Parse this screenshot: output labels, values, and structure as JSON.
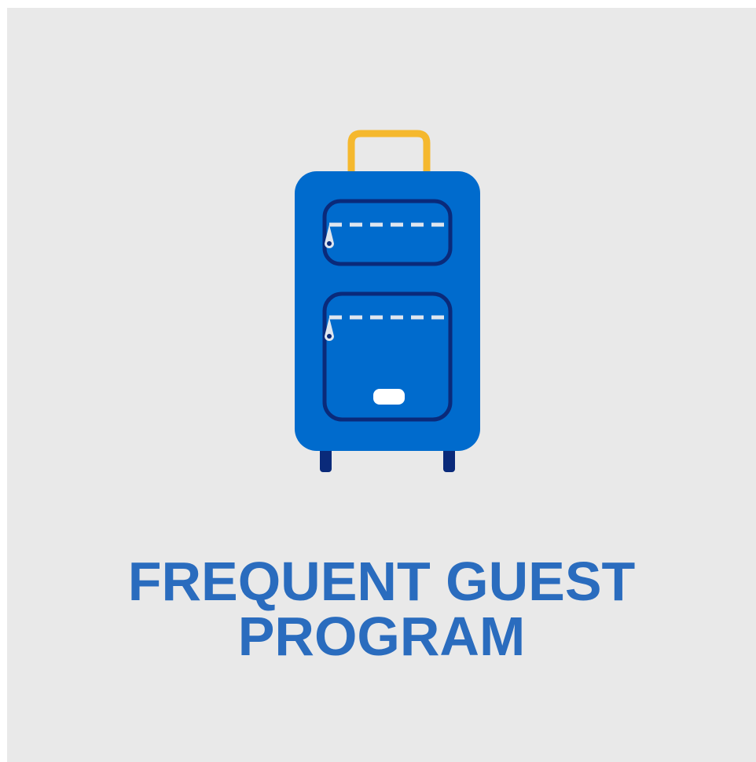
{
  "tile": {
    "title_line1": "FREQUENT GUEST",
    "title_line2": "PROGRAM",
    "icon": "suitcase-icon"
  },
  "colors": {
    "background": "#e9e9e9",
    "title": "#2a6cbe",
    "suitcase_body": "#006bcd",
    "suitcase_outline": "#0a2a7a",
    "handle": "#f5b82e",
    "zipper": "#dfe6ef"
  }
}
